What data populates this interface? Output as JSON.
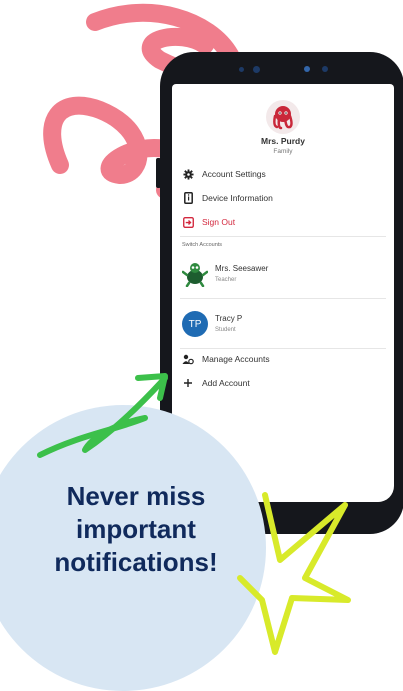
{
  "profile": {
    "name": "Mrs. Purdy",
    "role": "Family"
  },
  "menu": {
    "account_settings": "Account Settings",
    "device_information": "Device Information",
    "sign_out": "Sign Out"
  },
  "switch_accounts": {
    "label": "Switch Accounts",
    "accounts": [
      {
        "name": "Mrs. Seesawer",
        "role": "Teacher",
        "avatar_icon": "turtle-icon"
      },
      {
        "name": "Tracy P",
        "role": "Student",
        "initials": "TP",
        "avatar_color": "#1f6bb3"
      }
    ]
  },
  "actions": {
    "manage_accounts": "Manage Accounts",
    "add_account": "Add Account"
  },
  "promo": {
    "text": "Never miss important notifications!"
  },
  "colors": {
    "sign_out": "#d3283e",
    "pink_scribble": "#f07d8c",
    "green_arrow": "#3cc04a",
    "yellow_star": "#d8ea2a",
    "bubble": "#d8e6f3",
    "promo_text": "#102a5c"
  }
}
